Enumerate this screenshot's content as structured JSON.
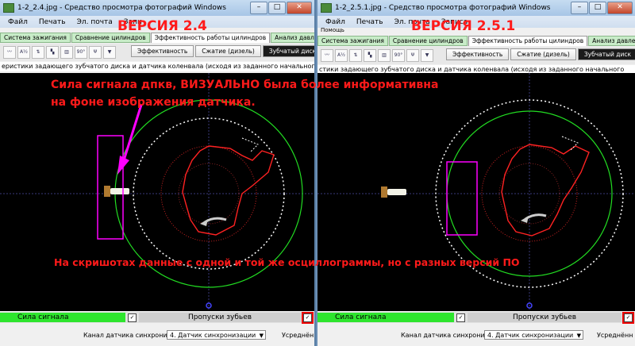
{
  "colors": {
    "signal_green": "#2ee52e",
    "annotation_red": "#ff1a1a",
    "magenta": "#ff00ff",
    "plot_bg": "#000000"
  },
  "left": {
    "title": "1-2_2.4.jpg - Средство просмотра фотографий Windows",
    "menu": [
      "Файл",
      "Печать",
      "Эл. почта",
      "Запи"
    ],
    "tabs": [
      "Система зажигания",
      "Сравнение цилиндров",
      "Эффективность работы цилиндров",
      "Анализ давления в цилиндре"
    ],
    "toolbar_buttons": [
      "Эффективность",
      "Сжатие (дизель)",
      "Зубчатый диск",
      "Оп"
    ],
    "description": "еристики задающего зубчатого диска и датчика коленвала (исходя из заданного начального ",
    "signal_label": "Сила сигнала",
    "skip_label": "Пропуски зубьев",
    "channel_label": "Канал датчика синхронизации",
    "channel_value": "4. Датчик синхронизации",
    "avg_label": "Усреднённ"
  },
  "right": {
    "title": "1-2_2.5.1.jpg - Средство просмотра фотографий Windows",
    "menu": [
      "Файл",
      "Печать",
      "Эл. почта",
      "Записа"
    ],
    "help_label": "Помощь",
    "tabs": [
      "Система зажигания",
      "Сравнение цилиндров",
      "Эффективность работы цилиндров",
      "Анализ давления в цилиндре"
    ],
    "toolbar_buttons": [
      "Эффективность",
      "Сжатие (дизель)",
      "Зубчатый диск",
      "Оп"
    ],
    "description": "стики задающего зубчатого диска и датчика коленвала (исходя из заданного начального",
    "signal_label": "Сила сигнала",
    "skip_label": "Пропуски зубьев",
    "channel_label": "Канал датчика синхронизации",
    "channel_value": "4. Датчик синхронизации",
    "avg_label": "Усреднённ"
  },
  "annotations": {
    "version_left": "ВЕРСИЯ 2.4",
    "version_right": "ВЕРСИЯ 2.5.1",
    "note_line1": "Сила сигнала дпкв, ВИЗУАЛЬНО была более информативна",
    "note_line2": "на фоне изображения датчика.",
    "bottom_note": "На скришотах данные с одной и той же осциллограммы, но с разных версий ПО"
  },
  "icons": [
    "minimize-icon",
    "maximize-icon",
    "close-icon",
    "sensor-icon",
    "rotation-arrow-icon"
  ]
}
